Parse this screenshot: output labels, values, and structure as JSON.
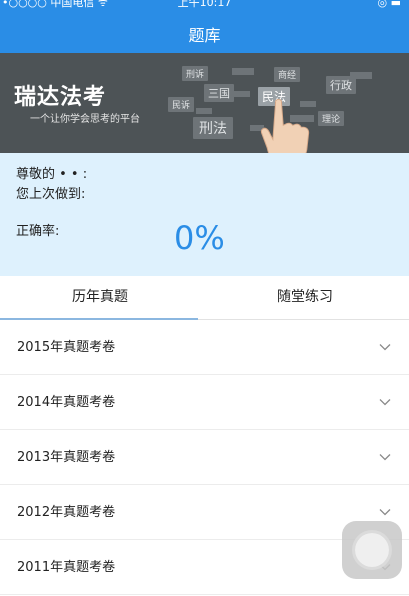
{
  "status_bar": {
    "carrier": "•○○○○ 中国电信 ᯤ",
    "time": "上午10:17",
    "icons": "◎ ▬"
  },
  "nav": {
    "title": "题库"
  },
  "banner": {
    "title": "瑞达法考",
    "subtitle": "一个让你学会思考的平台",
    "tags": [
      "刑诉",
      "商经",
      "三国",
      "行政",
      "民诉",
      "民法",
      "刑法",
      "理论"
    ]
  },
  "info": {
    "greeting": "尊敬的 • • :",
    "last_done": "您上次做到:",
    "accuracy_label": "正确率:",
    "accuracy_value": "0%"
  },
  "tabs": [
    {
      "label": "历年真题",
      "active": true
    },
    {
      "label": "随堂练习",
      "active": false
    }
  ],
  "exam_list": [
    {
      "label": "2015年真题考卷"
    },
    {
      "label": "2014年真题考卷"
    },
    {
      "label": "2013年真题考卷"
    },
    {
      "label": "2012年真题考卷"
    },
    {
      "label": "2011年真题考卷"
    }
  ],
  "colors": {
    "primary": "#2a8de6",
    "info_bg": "#def1fd",
    "banner_bg": "#4d5356"
  }
}
